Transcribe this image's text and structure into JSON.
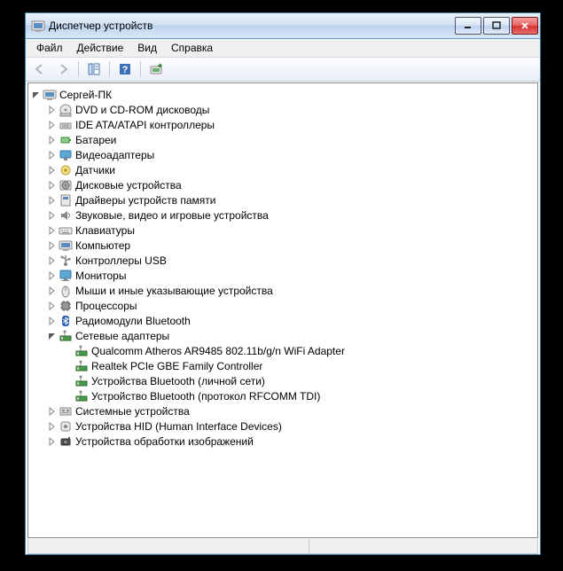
{
  "window": {
    "title": "Диспетчер устройств"
  },
  "menu": [
    "Файл",
    "Действие",
    "Вид",
    "Справка"
  ],
  "root": "Сергей-ПК",
  "cats": [
    {
      "icon": "disc",
      "label": "DVD и CD-ROM дисководы",
      "exp": false
    },
    {
      "icon": "ide",
      "label": "IDE ATA/ATAPI контроллеры",
      "exp": false
    },
    {
      "icon": "bat",
      "label": "Батареи",
      "exp": false
    },
    {
      "icon": "vid",
      "label": "Видеоадаптеры",
      "exp": false
    },
    {
      "icon": "sen",
      "label": "Датчики",
      "exp": false
    },
    {
      "icon": "hdd",
      "label": "Дисковые устройства",
      "exp": false
    },
    {
      "icon": "drv",
      "label": "Драйверы устройств памяти",
      "exp": false
    },
    {
      "icon": "snd",
      "label": "Звуковые, видео и игровые устройства",
      "exp": false
    },
    {
      "icon": "kbd",
      "label": "Клавиатуры",
      "exp": false
    },
    {
      "icon": "pc",
      "label": "Компьютер",
      "exp": false
    },
    {
      "icon": "usb",
      "label": "Контроллеры USB",
      "exp": false
    },
    {
      "icon": "mon",
      "label": "Мониторы",
      "exp": false
    },
    {
      "icon": "mou",
      "label": "Мыши и иные указывающие устройства",
      "exp": false
    },
    {
      "icon": "cpu",
      "label": "Процессоры",
      "exp": false
    },
    {
      "icon": "bt",
      "label": "Радиомодули Bluetooth",
      "exp": false
    },
    {
      "icon": "net",
      "label": "Сетевые адаптеры",
      "exp": true,
      "children": [
        "Qualcomm Atheros AR9485 802.11b/g/n WiFi Adapter",
        "Realtek PCIe GBE Family Controller",
        "Устройства Bluetooth (личной сети)",
        "Устройство Bluetooth (протокол RFCOMM TDI)"
      ]
    },
    {
      "icon": "sys",
      "label": "Системные устройства",
      "exp": false
    },
    {
      "icon": "hid",
      "label": "Устройства HID (Human Interface Devices)",
      "exp": false
    },
    {
      "icon": "img",
      "label": "Устройства обработки изображений",
      "exp": false
    }
  ]
}
